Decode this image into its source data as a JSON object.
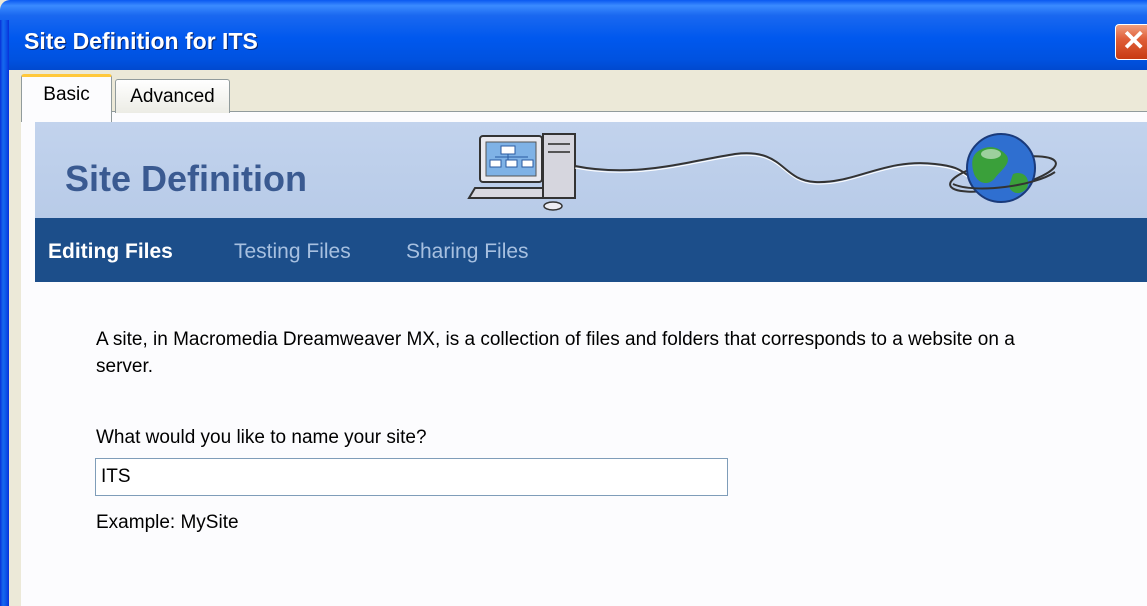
{
  "window": {
    "title": "Site Definition for ITS",
    "close_label": "✕"
  },
  "tabs": [
    {
      "label": "Basic",
      "selected": true
    },
    {
      "label": "Advanced",
      "selected": false
    }
  ],
  "header": {
    "title": "Site Definition",
    "art": [
      "computer-icon",
      "cable-icon",
      "globe-icon"
    ]
  },
  "nav": {
    "items": [
      {
        "label": "Editing Files",
        "active": true
      },
      {
        "label": "Testing Files",
        "active": false
      },
      {
        "label": "Sharing Files",
        "active": false
      }
    ]
  },
  "main": {
    "description": "A site, in Macromedia Dreamweaver MX, is a collection of files and folders that corresponds to a website on a server.",
    "question": "What would you like to name your site?",
    "site_name_value": "ITS",
    "example": "Example: MySite"
  },
  "colors": {
    "titlebar": "#0058ee",
    "header_band": "#c2d3ed",
    "header_title": "#3a5a91",
    "nav_band": "#1c4e8a",
    "nav_inactive": "#a7c0e0",
    "tab_highlight": "#ffc83c"
  }
}
